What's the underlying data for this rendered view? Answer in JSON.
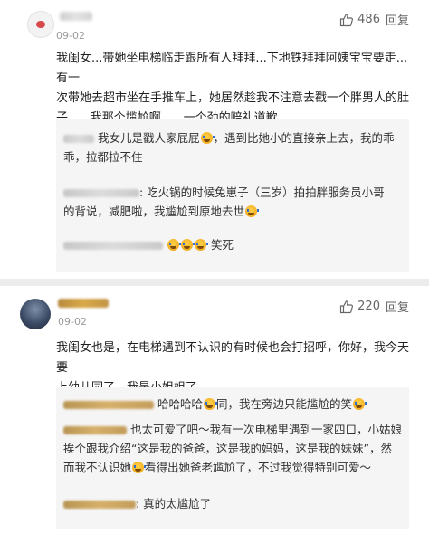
{
  "comment1": {
    "date": "09-02",
    "likes": "486",
    "reply_label": "回复",
    "text_lines": [
      "我闺女...带她坐电梯临走跟所有人拜拜...下地铁拜拜阿姨宝宝要走...有一",
      "次带她去超市坐在手推车上，她居然趁我不注意去戳一个胖男人的肚",
      "子......我那个尴尬啊......一个劲的赔礼道歉.........."
    ],
    "replies": [
      {
        "lines": [
          "我女儿是戳人家屁屁",
          "，遇到比她小的直接亲上去，我的乖",
          "乖，拉都拉不住"
        ]
      },
      {
        "lines": [
          ": 吃火锅的时候兔崽子（三岁）拍拍胖服务员小哥",
          "的背说，减肥啦，我尴尬到原地去世"
        ]
      },
      {
        "lines": [
          "笑死"
        ]
      }
    ]
  },
  "comment2": {
    "date": "09-02",
    "likes": "220",
    "reply_label": "回复",
    "text_lines": [
      "我闺女也是，在电梯遇到不认识的有时候也会打招呼，你好，我今天要",
      "上幼儿园了，我是小姐姐了"
    ],
    "replies": [
      {
        "lines": [
          "哈哈哈哈",
          "同，我在旁边只能尴尬的笑"
        ]
      },
      {
        "lines": [
          "也太可爱了吧～我有一次电梯里遇到一家四口，小姑娘",
          "挨个跟我介绍“这是我的爸爸，这是我的妈妈，这是我的妹妹”，然",
          "而我不认识她",
          "看得出她爸老尴尬了，不过我觉得特别可爱～"
        ]
      },
      {
        "lines": [
          ": 真的太尴尬了"
        ]
      }
    ]
  }
}
